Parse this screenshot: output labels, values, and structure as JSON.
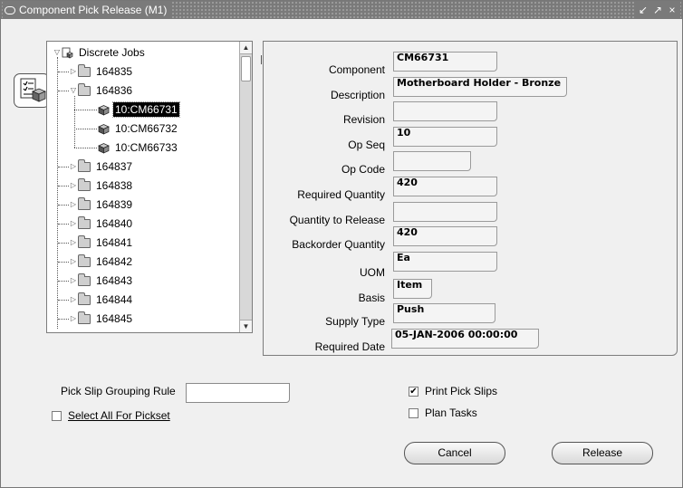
{
  "window": {
    "title": "Component Pick Release (M1)"
  },
  "title_buttons": {
    "minimize": "↙",
    "maximize": "↗",
    "close": "×"
  },
  "tree": {
    "root": "Discrete Jobs",
    "jobs": [
      {
        "label": "164835",
        "expanded": false
      },
      {
        "label": "164836",
        "expanded": true,
        "children": [
          "10:CM66731",
          "10:CM66732",
          "10:CM66733"
        ]
      },
      {
        "label": "164837",
        "expanded": false
      },
      {
        "label": "164838",
        "expanded": false
      },
      {
        "label": "164839",
        "expanded": false
      },
      {
        "label": "164840",
        "expanded": false
      },
      {
        "label": "164841",
        "expanded": false
      },
      {
        "label": "164842",
        "expanded": false
      },
      {
        "label": "164843",
        "expanded": false
      },
      {
        "label": "164844",
        "expanded": false
      },
      {
        "label": "164845",
        "expanded": false
      }
    ],
    "selected": "10:CM66731"
  },
  "details": {
    "component": {
      "label": "Component",
      "value": "CM66731"
    },
    "description": {
      "label": "Description",
      "value": "Motherboard Holder - Bronze"
    },
    "revision": {
      "label": "Revision",
      "value": ""
    },
    "op_seq": {
      "label": "Op Seq",
      "value": "10"
    },
    "op_code": {
      "label": "Op Code",
      "value": ""
    },
    "required_quantity": {
      "label": "Required Quantity",
      "value": "420"
    },
    "quantity_to_release": {
      "label": "Quantity to Release",
      "value": ""
    },
    "backorder_quantity": {
      "label": "Backorder Quantity",
      "value": "420"
    },
    "uom": {
      "label": "UOM",
      "value": "Ea"
    },
    "basis": {
      "label": "Basis",
      "value": "Item"
    },
    "supply_type": {
      "label": "Supply Type",
      "value": "Push"
    },
    "required_date": {
      "label": "Required Date",
      "value": "05-JAN-2006 00:00:00"
    }
  },
  "controls": {
    "pick_slip_grouping_rule": {
      "label": "Pick Slip Grouping Rule",
      "value": ""
    },
    "select_all_for_pickset": {
      "label": "Select All For Pickset",
      "checked": false
    },
    "print_pick_slips": {
      "label": "Print Pick Slips",
      "checked": true
    },
    "plan_tasks": {
      "label": "Plan Tasks",
      "checked": false
    },
    "cancel_label": "Cancel",
    "release_label": "Release",
    "check_mark": "✔"
  }
}
